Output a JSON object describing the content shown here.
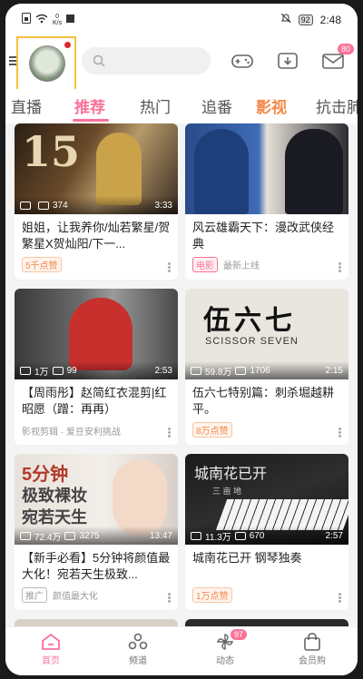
{
  "status_bar": {
    "net_speed": "0",
    "net_unit": "K/s",
    "battery": "92",
    "time": "2:48"
  },
  "colors": {
    "accent": "#fb7299",
    "highlight": "#f5884a"
  },
  "header": {
    "notification_badge": "80"
  },
  "tabs": [
    {
      "label": "直播"
    },
    {
      "label": "推荐"
    },
    {
      "label": "热门"
    },
    {
      "label": "追番"
    },
    {
      "label": "影视"
    },
    {
      "label": "抗击肺"
    }
  ],
  "feed": [
    {
      "views": "",
      "comments": "374",
      "duration": "3:33",
      "title": "姐姐，让我养你/灿若繁星/贺繁星X贺灿阳/下一...",
      "tag": "5千点赞",
      "tag_style": "orange",
      "source": ""
    },
    {
      "views": "",
      "comments": "",
      "duration": "",
      "title": "风云雄霸天下：漫改武侠经典",
      "tag": "电影",
      "tag_style": "pink",
      "source": "最新上线"
    },
    {
      "views": "1万",
      "comments": "99",
      "duration": "2:53",
      "title": "【周雨彤】赵简红衣混剪|红昭愿（蹭：再再）",
      "tag": "",
      "tag_style": "",
      "source": "影视剪辑 · 爱豆安利挑战"
    },
    {
      "views": "59.8万",
      "comments": "1706",
      "duration": "2:15",
      "title": "伍六七特别篇：刺杀堀越耕平。",
      "tag": "8万点赞",
      "tag_style": "orange",
      "source": ""
    },
    {
      "views": "72.4万",
      "comments": "3275",
      "duration": "13:47",
      "title": "【新手必看】5分钟将颜值最大化！宛若天生极致...",
      "tag": "推广",
      "tag_style": "grey",
      "source": "颜值最大化"
    },
    {
      "views": "11.3万",
      "comments": "670",
      "duration": "2:57",
      "title": "城南花已开 钢琴独奏",
      "tag": "1万点赞",
      "tag_style": "orange",
      "source": ""
    }
  ],
  "thumb_text": {
    "card1_number": "15",
    "card3_poster_title": "伍六七",
    "card3_poster_sub": "SCISSOR SEVEN",
    "card4_line1": "5分钟",
    "card4_line2": "极致裸妆",
    "card4_line3": "宛若天生",
    "card5_text": "城南花已开",
    "card5_sub": "三 亩 地"
  },
  "bottom_nav": [
    {
      "label": "首页"
    },
    {
      "label": "频道"
    },
    {
      "label": "动态",
      "badge": "97"
    },
    {
      "label": "会员购"
    }
  ]
}
